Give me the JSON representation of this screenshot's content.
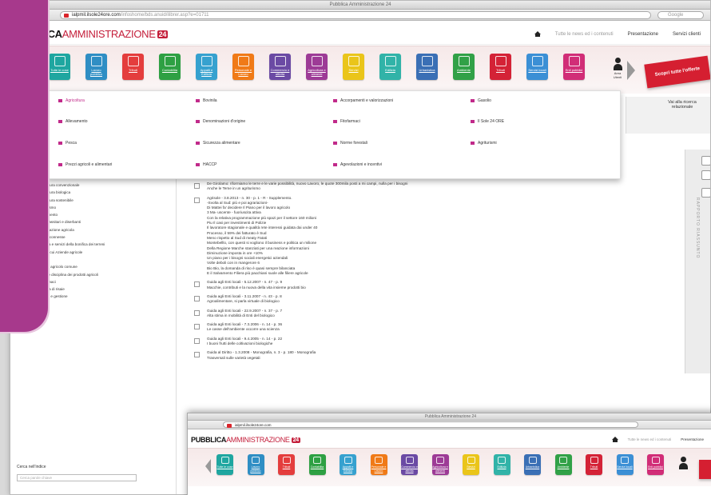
{
  "window": {
    "title": "Pubblica Amministrazione 24",
    "url_host": "ialpmil.ilsole24ore.com",
    "url_rest": "/infoshome/bds.anuid/ilibrer.asp?e=01711",
    "search_placeholder": "Google"
  },
  "header": {
    "logo_bold": "PUBBLICA",
    "logo_light": "AMMINISTRAZIONE",
    "logo_badge": "24",
    "links": [
      "Tutte le news ed i contenuti",
      "Presentazione",
      "Servizi clienti"
    ]
  },
  "categories": [
    {
      "label": "Tutte le cose",
      "color": "#1fa6a0"
    },
    {
      "label": "Lavoro pubblico",
      "color": "#2f8ec4"
    },
    {
      "label": "Tributi",
      "color": "#e43d3d"
    },
    {
      "label": "Contabilita",
      "color": "#2ea043"
    },
    {
      "label": "Appalti e Edilizia",
      "color": "#36a1cf"
    },
    {
      "label": "Personale e Lavoro",
      "color": "#f07a17"
    },
    {
      "label": "Commercio e attivita",
      "color": "#6b4aa4"
    },
    {
      "label": "Agricoltura e alimenti",
      "color": "#9d3b96"
    },
    {
      "label": "Servizi",
      "color": "#eac51a"
    },
    {
      "label": "Edilizia",
      "color": "#31b3a8"
    },
    {
      "label": "Urbanistica",
      "color": "#3a6fb5"
    },
    {
      "label": "Ambiente",
      "color": "#31a147"
    },
    {
      "label": "Tributi",
      "color": "#d42236"
    },
    {
      "label": "Servizi locali",
      "color": "#3b8fd5"
    },
    {
      "label": "Enti pubblici",
      "color": "#d12d77"
    }
  ],
  "person_label": "Area Utenti",
  "buy_label": "Scopri tutte l'offerte",
  "dropdown": {
    "columns": [
      [
        "Agricoltura",
        "Allevamento",
        "Pesca",
        "Prezzi agricoli e alimentari"
      ],
      [
        "Bovinila",
        "Denominazioni d'origine",
        "Sicurezza alimentare",
        "HACCP"
      ],
      [
        "Accorpamenti e valorizzazioni",
        "Fitofarmaci",
        "Norme forestali",
        "Agevolazioni e incentivi"
      ],
      [
        "Gasolio",
        "Il Sole 24 ORE",
        "Agriturismi"
      ]
    ]
  },
  "right_toolbar": {
    "goto_label": "Vai alla ricerca relazionale",
    "strip_label": "RAPPORTO RIASSUNTO"
  },
  "tree": [
    "Agricoltura convenzionale",
    "Agricoltura biologica",
    "Agricoltura sostenibile",
    "Agriturismo",
    "Allevamento",
    "Antiparassitari e diserbanti",
    "Assicurazione agricola",
    "Attivita connesse",
    "Bonifica e servizi della bonifica dei terreni",
    "Cavi in cui Aziende agricole",
    "Colture",
    "Credito agricolo comune",
    "Danni e disciplina dei prodotti agricoli",
    "Fitofarmaci",
    "Impresa di risaie",
    "Mercati e gestione"
  ],
  "search_panel": {
    "title": "Cerca nell'indice",
    "placeholder": "Cerca parole chiave"
  },
  "doc_entries": [
    "De Girolamo: riformiamo le terre e le varie possibilità, nuovo Lavoro, le quote 300mila posti a mi campi, nulla per i bisogni\nAnche le Teme in un agriturismo",
    "Agrisole - 3.8.2013 - n. 30 - p. 1 - R - Supplemento.\n-Svolta al Sud: più e poi agrariazioni-\nDi Mattei fa' decidere Il Piano per il lavoro agricolo\n3 Ma- uscente - fuoriuscita attiva\nCon la relativa programmazione più spazi per il settore 160 milioni\nPiu Il casi per investimenti di Polizie\nIl lavoratore stagionale e qualità rete interessi guidata dai under 40\nProcesso, il 59% dei fatturato è Sud\nMeno rispetto al Sud di meaty Fatati\nMontebelllo, con questi si vogliono il business e politica un milione\nDella Regione Marche stanziati per una reazione informazioni\nDiminuzione imposta in ore +10%\nUn piano per i bisogni sociali energetici aziendali\nVolte deboli con in mangerore 6\nBio Bio, la domanda di riso è quasi sempre bilanciata\nE il Salvamento Filiera più pacchiani suole alle filiere agricole",
    "Guida agli Enti locali - 5.12.2007 - n. 47 - p. 9\nMacchie, contributi e la nuova della vita insieme prodotti bio",
    "Guida agli Enti locali - 3.11.2007 - n. 43 - p. 8\nAgroalimentare, si parla virtuale di biologico",
    "Guida agli Enti locali - 22.9.2007 - n. 37 - p. 7\nAlta stima in mobilità di Enti del biologico",
    "Guida agli Enti locali - 7.3.2006 - n. 14 - p. 36\nLe casse dell'ambiente occorre una scienza",
    "Guida agli Enti locali - 9.4.2005 - n. 14 - p. 22\nI buoni frutti delle coltivazioni biologiche",
    "Guida al Diritto - 1.3.2008 - Monografia, n. 3 - p. 180 - Monografia\nTrasversali sulle varietà vegetali"
  ],
  "window2": {
    "title": "Pubblica Amministrazione 24",
    "url_host": "ialpmil.ilsole24ore.com",
    "links": [
      "Tutte le news ed i contenuti",
      "Presentazione"
    ]
  }
}
